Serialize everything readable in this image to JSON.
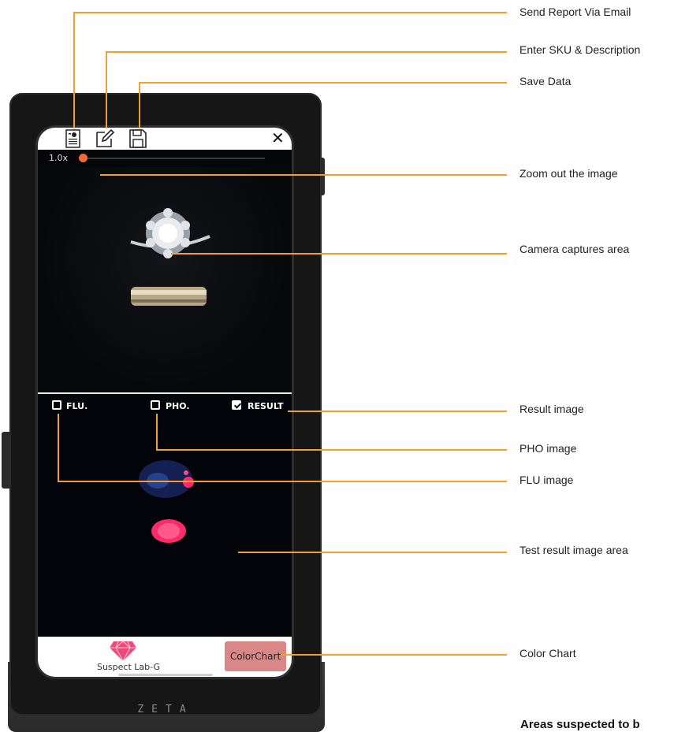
{
  "callouts": {
    "send_report": "Send Report Via Email",
    "enter_sku": "Enter SKU & Description",
    "save_data": "Save Data",
    "zoom_out": "Zoom out the image",
    "camera_area": "Camera captures area",
    "result_image": "Result image",
    "pho_image": "PHO image",
    "flu_image": "FLU image",
    "test_result_area": "Test result image area",
    "color_chart": "Color Chart"
  },
  "footer_note": "Areas suspected to b",
  "device": {
    "brand": "ZETA"
  },
  "app": {
    "zoom": {
      "label": "1.0x",
      "level": 0.0
    },
    "checkboxes": [
      {
        "label": "FLU.",
        "checked": false
      },
      {
        "label": "PHO.",
        "checked": false
      },
      {
        "label": "RESULT",
        "checked": true
      }
    ],
    "bottom": {
      "suspect_label": "Suspect Lab-G",
      "colorchart_label": "ColorChart"
    },
    "icons": [
      "report-icon",
      "edit-icon",
      "save-icon",
      "close-icon",
      "gem-icon"
    ]
  },
  "colors": {
    "accent_line": "#f0a030",
    "zoom_knob": "#f06a3b",
    "colorchart_button": "#d98787",
    "gem": "#f04a7a"
  }
}
